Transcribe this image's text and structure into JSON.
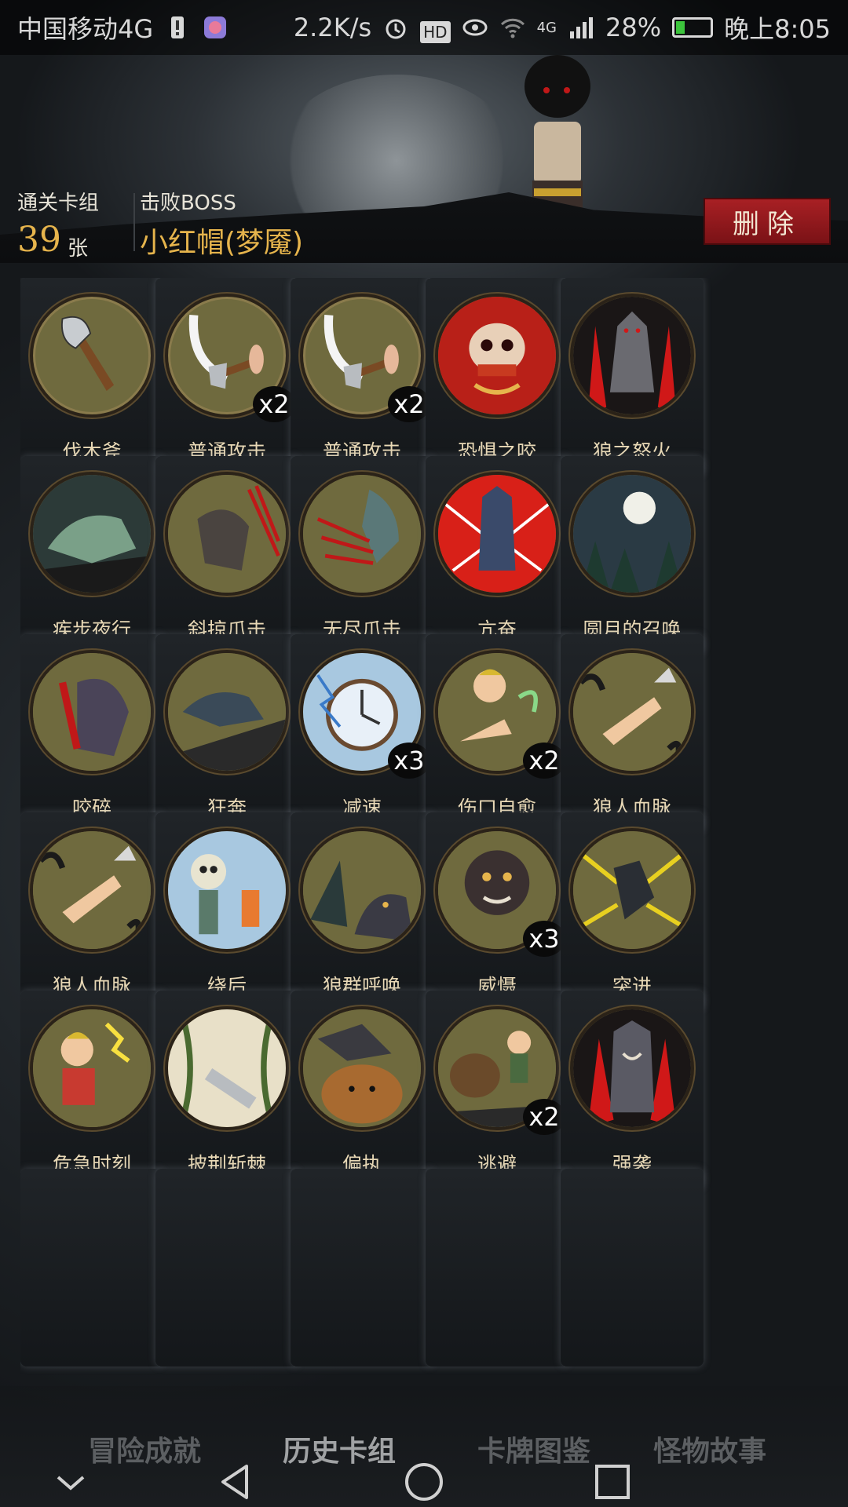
{
  "status_bar": {
    "carrier": "中国移动4G",
    "speed": "2.2K/s",
    "hd": "HD",
    "network": "4G",
    "battery": "28%",
    "battery_level": 0.28,
    "time": "晚上8:05"
  },
  "summary": {
    "cleared_label": "通关卡组",
    "count": "39",
    "unit": "张",
    "boss_label": "击败BOSS",
    "boss_name": "小红帽(梦魇)",
    "delete_label": "删除"
  },
  "cards": [
    {
      "name": "伐木斧",
      "icon": "axe-icon",
      "mult": ""
    },
    {
      "name": "普通攻击",
      "icon": "axe-swing-icon",
      "mult": "x2"
    },
    {
      "name": "普通攻击",
      "icon": "axe-swing-icon",
      "mult": "x2"
    },
    {
      "name": "恐惧之咬",
      "icon": "skull-bite-icon",
      "mult": ""
    },
    {
      "name": "狼之怒火",
      "icon": "wolf-rage-icon",
      "mult": ""
    },
    {
      "name": "疾步夜行",
      "icon": "night-run-icon",
      "mult": ""
    },
    {
      "name": "斜掠爪击",
      "icon": "claw-slash-icon",
      "mult": ""
    },
    {
      "name": "无尽爪击",
      "icon": "endless-claw-icon",
      "mult": ""
    },
    {
      "name": "亢奋",
      "icon": "frenzy-wolf-icon",
      "mult": ""
    },
    {
      "name": "圆月的召唤",
      "icon": "full-moon-icon",
      "mult": ""
    },
    {
      "name": "咬碎",
      "icon": "crush-bite-icon",
      "mult": ""
    },
    {
      "name": "狂奔",
      "icon": "wolf-sprint-icon",
      "mult": ""
    },
    {
      "name": "减速",
      "icon": "stopwatch-icon",
      "mult": "x3"
    },
    {
      "name": "伤口自愈",
      "icon": "heal-hand-icon",
      "mult": "x2"
    },
    {
      "name": "狼人血脉",
      "icon": "werewolf-hand-icon",
      "mult": ""
    },
    {
      "name": "狼人血脉",
      "icon": "werewolf-hand-icon",
      "mult": ""
    },
    {
      "name": "绕后",
      "icon": "skeleton-icon",
      "mult": ""
    },
    {
      "name": "狼群呼唤",
      "icon": "howl-pack-icon",
      "mult": ""
    },
    {
      "name": "威慑",
      "icon": "beast-roar-icon",
      "mult": "x3"
    },
    {
      "name": "突进",
      "icon": "dash-wolf-icon",
      "mult": ""
    },
    {
      "name": "危急时刻",
      "icon": "crisis-icon",
      "mult": ""
    },
    {
      "name": "披荆斩棘",
      "icon": "thorn-axe-icon",
      "mult": ""
    },
    {
      "name": "偏执",
      "icon": "wolf-bear-icon",
      "mult": ""
    },
    {
      "name": "逃避",
      "icon": "escape-icon",
      "mult": "x2"
    },
    {
      "name": "强袭",
      "icon": "werewolf-roar-icon",
      "mult": ""
    }
  ],
  "tabs": [
    {
      "label": "冒险成就",
      "active": false
    },
    {
      "label": "历史卡组",
      "active": true
    },
    {
      "label": "卡牌图鉴",
      "active": false
    },
    {
      "label": "怪物故事",
      "active": false
    }
  ],
  "colors": {
    "accent_gold": "#e6b44c",
    "delete_red": "#a82024",
    "disc_olive": "#6f6a3e",
    "wolf_red": "#c0201c",
    "sky_blue": "#8ab0c8"
  }
}
